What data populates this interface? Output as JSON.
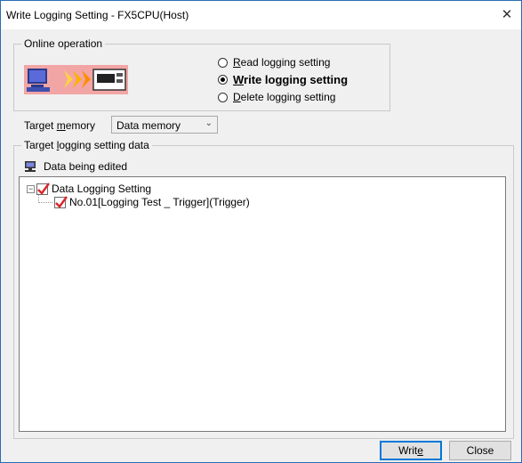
{
  "window": {
    "title": "Write Logging Setting - FX5CPU(Host)",
    "close_glyph": "✕"
  },
  "online_operation": {
    "label": "Online operation",
    "image_icon": "pc-to-plc-icon",
    "options": [
      {
        "pre": "",
        "u": "R",
        "post": "ead logging setting",
        "checked": false
      },
      {
        "pre": "",
        "u": "W",
        "post": "rite logging setting",
        "checked": true
      },
      {
        "pre": "",
        "u": "D",
        "post": "elete logging setting",
        "checked": false
      }
    ]
  },
  "target_memory": {
    "label_pre": "Target ",
    "label_u": "m",
    "label_post": "emory",
    "value": "Data memory"
  },
  "target_logging": {
    "label_pre": "Target ",
    "label_u": "l",
    "label_post": "ogging setting data",
    "edited_text": "Data being edited",
    "tree": {
      "root": {
        "label": "Data Logging Setting",
        "expander": "−",
        "checked": true
      },
      "children": [
        {
          "label": "No.01[Logging Test _ Trigger](Trigger)",
          "checked": true
        }
      ]
    }
  },
  "buttons": {
    "write_pre": "Writ",
    "write_u": "e",
    "write_post": "",
    "close": "Close"
  },
  "colors": {
    "accent": "#0078d7",
    "check_red": "#d9262c"
  }
}
